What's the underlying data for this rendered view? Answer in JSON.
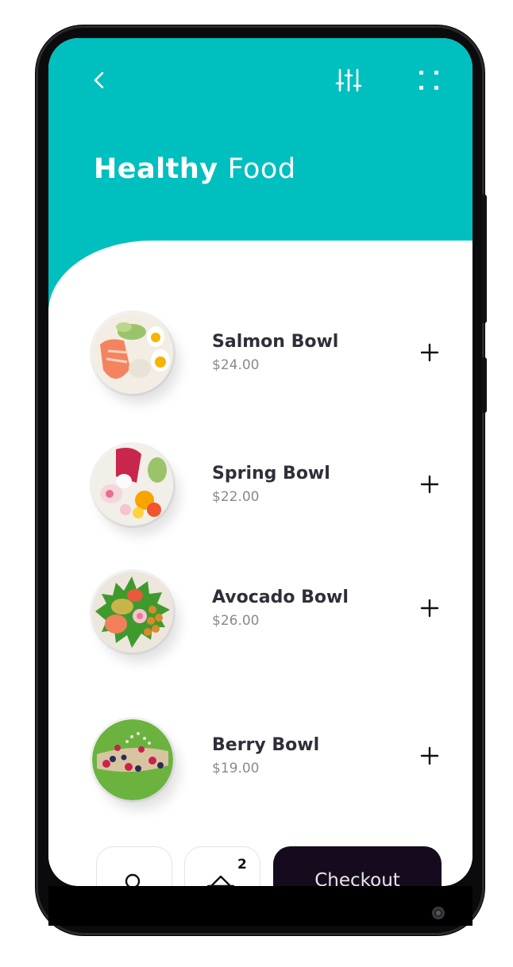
{
  "header": {
    "title_bold": "Healthy",
    "title_light": "Food",
    "icons": [
      "chevron-left-icon",
      "sliders-icon",
      "grid-dots-icon"
    ]
  },
  "menu": {
    "items": [
      {
        "name": "Salmon Bowl",
        "price": "$24.00",
        "image": "salmon-bowl-image"
      },
      {
        "name": "Spring Bowl",
        "price": "$22.00",
        "image": "spring-bowl-image"
      },
      {
        "name": "Avocado Bowl",
        "price": "$26.00",
        "image": "avocado-bowl-image"
      },
      {
        "name": "Berry Bowl",
        "price": "$19.00",
        "image": "berry-bowl-image"
      }
    ],
    "add_icon": "plus-icon"
  },
  "bottom": {
    "basket_count": "2",
    "checkout_label": "Checkout",
    "icons": [
      "user-icon",
      "basket-icon"
    ]
  },
  "colors": {
    "accent": "#00bfbf",
    "text_dark": "#2f2f3a",
    "price_gray": "#8a8a8a",
    "checkout_bg": "#160b1e"
  }
}
